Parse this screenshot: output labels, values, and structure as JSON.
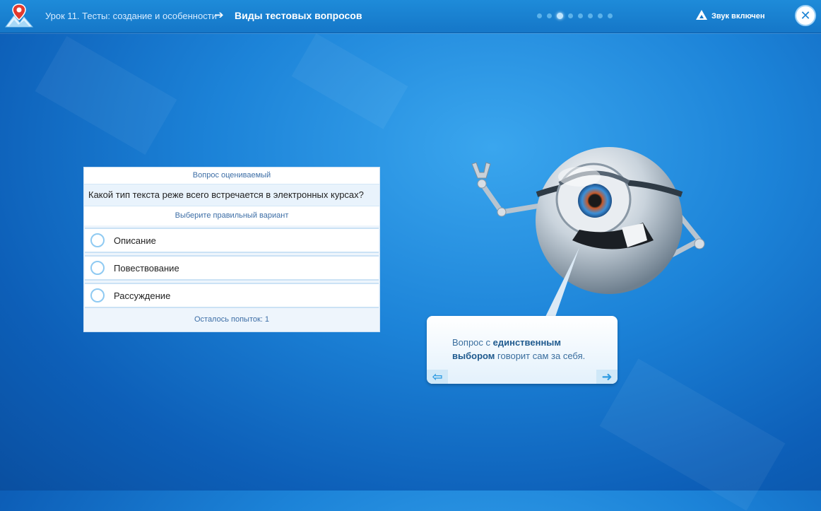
{
  "header": {
    "breadcrumb": "Урок 11. Тесты: создание и особенности",
    "arrow": "➔",
    "title": "Виды тестовых вопросов",
    "progress": {
      "total": 8,
      "current": 3
    },
    "sound_label": "Звук включен",
    "close_glyph": "✕"
  },
  "quiz": {
    "type_label": "Вопрос оцениваемый",
    "question": "Какой тип текста реже всего встречается в электронных курсах?",
    "hint": "Выберите правильный вариант",
    "options": [
      {
        "label": "Описание"
      },
      {
        "label": "Повествование"
      },
      {
        "label": "Рассуждение"
      }
    ],
    "attempts": "Осталось попыток: 1"
  },
  "speech": {
    "text_before": "Вопрос с ",
    "text_bold": "единственным выбором",
    "text_after": " говорит сам за себя.",
    "prev_glyph": "⇦",
    "next_glyph": "➜"
  },
  "colors": {
    "accent": "#1e84d4",
    "background": "#1c83d8"
  }
}
